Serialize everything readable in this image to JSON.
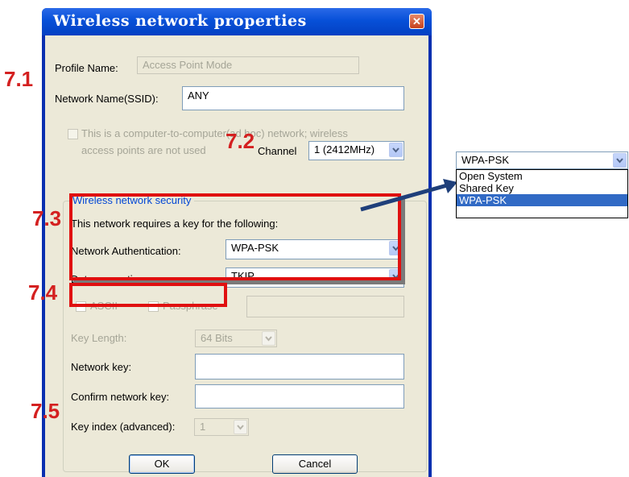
{
  "dialog": {
    "title": "Wireless network properties",
    "close_glyph": "✕",
    "profile_name_label": "Profile Name:",
    "profile_name_value": "Access Point Mode",
    "ssid_label": "Network Name(SSID):",
    "ssid_value": "ANY",
    "adhoc_line1": "This is a computer-to-computer(ad hoc) network; wireless",
    "adhoc_line2": "access points are not used",
    "channel_label": "Channel",
    "channel_value": "1  (2412MHz)",
    "security_group_title": "Wireless network security",
    "security_requires": "This network requires a key for the following:",
    "auth_label": "Network Authentication:",
    "auth_value": "WPA-PSK",
    "encryption_label": "Data encryption:",
    "encryption_value": "TKIP",
    "ascii_label": "ASCII",
    "passphrase_label": "Passphrase",
    "key_length_label": "Key Length:",
    "key_length_value": "64 Bits",
    "network_key_label": "Network key:",
    "confirm_key_label": "Confirm network key:",
    "key_index_label": "Key index (advanced):",
    "key_index_value": "1",
    "ok_label": "OK",
    "cancel_label": "Cancel"
  },
  "annotations": {
    "a71": "7.1",
    "a72": "7.2",
    "a73": "7.3",
    "a74": "7.4",
    "a75": "7.5"
  },
  "auth_popup": {
    "selected": "WPA-PSK",
    "options": [
      "Open System",
      "Shared Key",
      "WPA-PSK"
    ],
    "highlighted_index": 2
  },
  "colors": {
    "annotation_red": "#d42020",
    "title_blue": "#0750d8",
    "arrow": "#1f3f7a",
    "selection": "#316ac5"
  }
}
